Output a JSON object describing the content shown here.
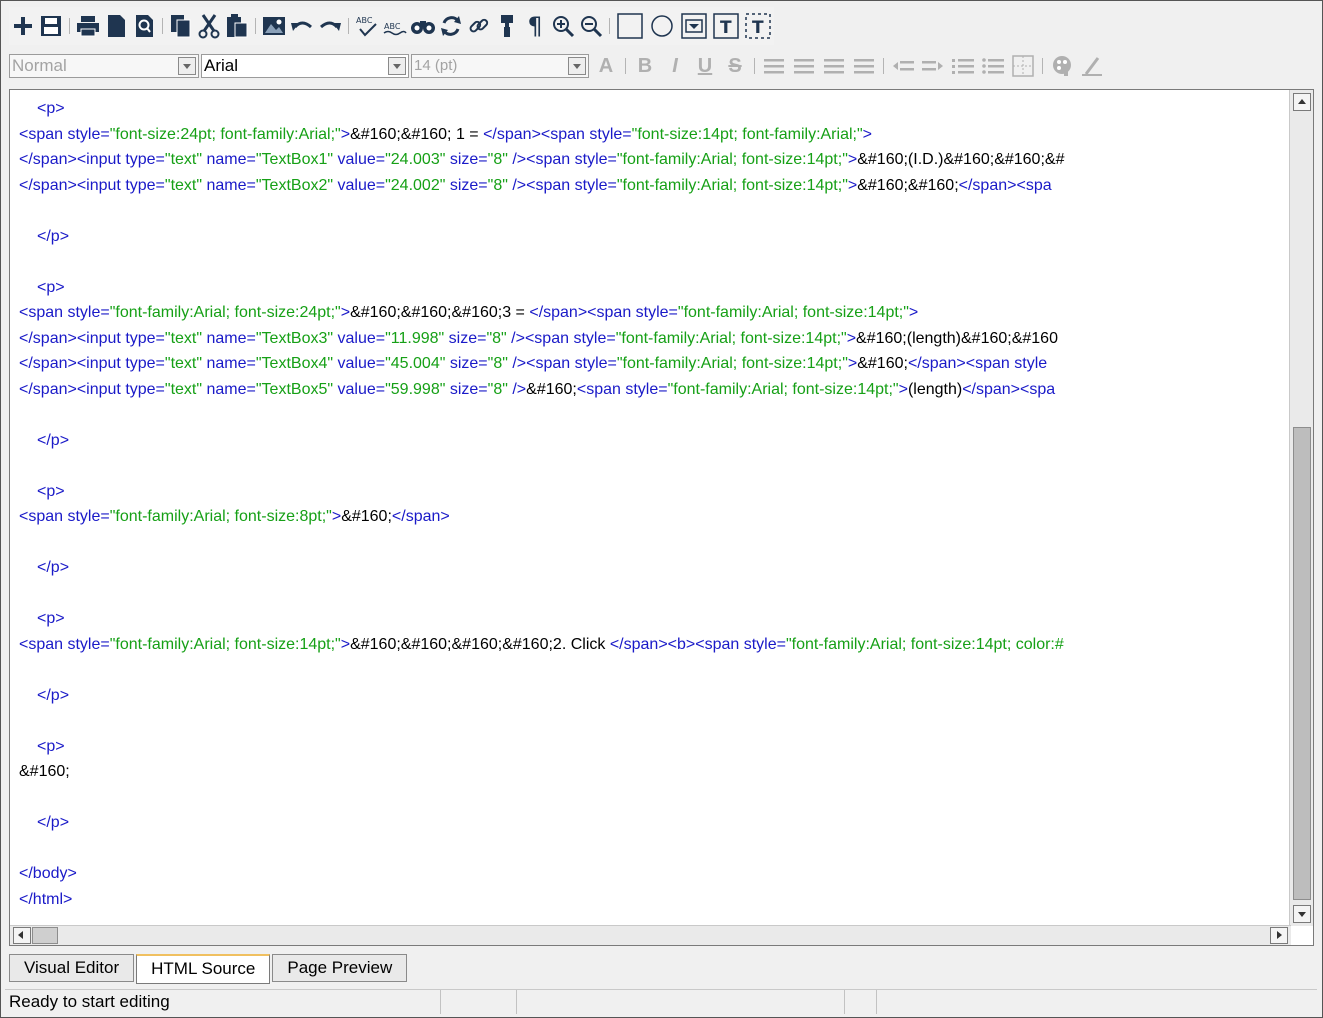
{
  "toolbar_main": {
    "buttons": [
      "new",
      "save",
      "print",
      "new-page",
      "print-preview",
      "copy",
      "cut",
      "paste",
      "insert-image",
      "undo",
      "redo",
      "spell-check",
      "spell-check-alt",
      "find",
      "replace",
      "link",
      "format-painter",
      "paragraph-marks",
      "zoom-in",
      "zoom-out",
      "insert-textbox",
      "insert-radio",
      "insert-dropdown",
      "insert-text-field",
      "insert-text-field-dashed"
    ]
  },
  "toolbar_format": {
    "style_value": "Normal",
    "font_value": "Arial",
    "size_value": "14 (pt)",
    "font_color_label": "A",
    "bold_label": "B",
    "italic_label": "I",
    "underline_label": "U",
    "strike_label": "S"
  },
  "code_lines": [
    {
      "indent": true,
      "parts": [
        {
          "t": "tag",
          "s": "<p>"
        }
      ]
    },
    {
      "indent": false,
      "parts": [
        {
          "t": "tag",
          "s": "<span "
        },
        {
          "t": "attr",
          "s": "style="
        },
        {
          "t": "val",
          "s": "\"font-size:24pt; font-family:Arial;\""
        },
        {
          "t": "tag",
          "s": ">"
        },
        {
          "t": "txt",
          "s": "&#160;&#160; 1 = "
        },
        {
          "t": "tag",
          "s": "</span><span "
        },
        {
          "t": "attr",
          "s": "style="
        },
        {
          "t": "val",
          "s": "\"font-size:14pt; font-family:Arial;\""
        },
        {
          "t": "tag",
          "s": ">"
        }
      ]
    },
    {
      "indent": false,
      "parts": [
        {
          "t": "tag",
          "s": "</span><input "
        },
        {
          "t": "attr",
          "s": "type="
        },
        {
          "t": "val",
          "s": "\"text\""
        },
        {
          "t": "attr",
          "s": " name="
        },
        {
          "t": "val",
          "s": "\"TextBox1\""
        },
        {
          "t": "attr",
          "s": " value="
        },
        {
          "t": "val",
          "s": "\"24.003\""
        },
        {
          "t": "attr",
          "s": " size="
        },
        {
          "t": "val",
          "s": "\"8\""
        },
        {
          "t": "tag",
          "s": " /><span "
        },
        {
          "t": "attr",
          "s": "style="
        },
        {
          "t": "val",
          "s": "\"font-family:Arial; font-size:14pt;\""
        },
        {
          "t": "tag",
          "s": ">"
        },
        {
          "t": "txt",
          "s": "&#160;(I.D.)&#160;&#160;&#"
        }
      ]
    },
    {
      "indent": false,
      "parts": [
        {
          "t": "tag",
          "s": "</span><input "
        },
        {
          "t": "attr",
          "s": "type="
        },
        {
          "t": "val",
          "s": "\"text\""
        },
        {
          "t": "attr",
          "s": " name="
        },
        {
          "t": "val",
          "s": "\"TextBox2\""
        },
        {
          "t": "attr",
          "s": " value="
        },
        {
          "t": "val",
          "s": "\"24.002\""
        },
        {
          "t": "attr",
          "s": " size="
        },
        {
          "t": "val",
          "s": "\"8\""
        },
        {
          "t": "tag",
          "s": " /><span "
        },
        {
          "t": "attr",
          "s": "style="
        },
        {
          "t": "val",
          "s": "\"font-family:Arial; font-size:14pt;\""
        },
        {
          "t": "tag",
          "s": ">"
        },
        {
          "t": "txt",
          "s": "&#160;&#160;"
        },
        {
          "t": "tag",
          "s": "</span><spa"
        }
      ]
    },
    {
      "indent": false,
      "parts": []
    },
    {
      "indent": true,
      "parts": [
        {
          "t": "tag",
          "s": "</p>"
        }
      ]
    },
    {
      "indent": false,
      "parts": []
    },
    {
      "indent": true,
      "parts": [
        {
          "t": "tag",
          "s": "<p>"
        }
      ]
    },
    {
      "indent": false,
      "parts": [
        {
          "t": "tag",
          "s": "<span "
        },
        {
          "t": "attr",
          "s": "style="
        },
        {
          "t": "val",
          "s": "\"font-family:Arial; font-size:24pt;\""
        },
        {
          "t": "tag",
          "s": ">"
        },
        {
          "t": "txt",
          "s": "&#160;&#160;&#160;3 = "
        },
        {
          "t": "tag",
          "s": "</span><span "
        },
        {
          "t": "attr",
          "s": "style="
        },
        {
          "t": "val",
          "s": "\"font-family:Arial; font-size:14pt;\""
        },
        {
          "t": "tag",
          "s": ">"
        }
      ]
    },
    {
      "indent": false,
      "parts": [
        {
          "t": "tag",
          "s": "</span><input "
        },
        {
          "t": "attr",
          "s": "type="
        },
        {
          "t": "val",
          "s": "\"text\""
        },
        {
          "t": "attr",
          "s": " name="
        },
        {
          "t": "val",
          "s": "\"TextBox3\""
        },
        {
          "t": "attr",
          "s": " value="
        },
        {
          "t": "val",
          "s": "\"11.998\""
        },
        {
          "t": "attr",
          "s": " size="
        },
        {
          "t": "val",
          "s": "\"8\""
        },
        {
          "t": "tag",
          "s": " /><span "
        },
        {
          "t": "attr",
          "s": "style="
        },
        {
          "t": "val",
          "s": "\"font-family:Arial; font-size:14pt;\""
        },
        {
          "t": "tag",
          "s": ">"
        },
        {
          "t": "txt",
          "s": "&#160;(length)&#160;&#160"
        }
      ]
    },
    {
      "indent": false,
      "parts": [
        {
          "t": "tag",
          "s": "</span><input "
        },
        {
          "t": "attr",
          "s": "type="
        },
        {
          "t": "val",
          "s": "\"text\""
        },
        {
          "t": "attr",
          "s": " name="
        },
        {
          "t": "val",
          "s": "\"TextBox4\""
        },
        {
          "t": "attr",
          "s": " value="
        },
        {
          "t": "val",
          "s": "\"45.004\""
        },
        {
          "t": "attr",
          "s": " size="
        },
        {
          "t": "val",
          "s": "\"8\""
        },
        {
          "t": "tag",
          "s": " /><span "
        },
        {
          "t": "attr",
          "s": "style="
        },
        {
          "t": "val",
          "s": "\"font-family:Arial; font-size:14pt;\""
        },
        {
          "t": "tag",
          "s": ">"
        },
        {
          "t": "txt",
          "s": "&#160;"
        },
        {
          "t": "tag",
          "s": "</span><span style"
        }
      ]
    },
    {
      "indent": false,
      "parts": [
        {
          "t": "tag",
          "s": "</span><input "
        },
        {
          "t": "attr",
          "s": "type="
        },
        {
          "t": "val",
          "s": "\"text\""
        },
        {
          "t": "attr",
          "s": " name="
        },
        {
          "t": "val",
          "s": "\"TextBox5\""
        },
        {
          "t": "attr",
          "s": " value="
        },
        {
          "t": "val",
          "s": "\"59.998\""
        },
        {
          "t": "attr",
          "s": " size="
        },
        {
          "t": "val",
          "s": "\"8\""
        },
        {
          "t": "tag",
          "s": " />"
        },
        {
          "t": "txt",
          "s": "&#160;"
        },
        {
          "t": "tag",
          "s": "<span "
        },
        {
          "t": "attr",
          "s": "style="
        },
        {
          "t": "val",
          "s": "\"font-family:Arial; font-size:14pt;\""
        },
        {
          "t": "tag",
          "s": ">"
        },
        {
          "t": "txt",
          "s": "(length)"
        },
        {
          "t": "tag",
          "s": "</span><spa"
        }
      ]
    },
    {
      "indent": false,
      "parts": []
    },
    {
      "indent": true,
      "parts": [
        {
          "t": "tag",
          "s": "</p>"
        }
      ]
    },
    {
      "indent": false,
      "parts": []
    },
    {
      "indent": true,
      "parts": [
        {
          "t": "tag",
          "s": "<p>"
        }
      ]
    },
    {
      "indent": false,
      "parts": [
        {
          "t": "tag",
          "s": "<span "
        },
        {
          "t": "attr",
          "s": "style="
        },
        {
          "t": "val",
          "s": "\"font-family:Arial; font-size:8pt;\""
        },
        {
          "t": "tag",
          "s": ">"
        },
        {
          "t": "txt",
          "s": "&#160;"
        },
        {
          "t": "tag",
          "s": "</span>"
        }
      ]
    },
    {
      "indent": false,
      "parts": []
    },
    {
      "indent": true,
      "parts": [
        {
          "t": "tag",
          "s": "</p>"
        }
      ]
    },
    {
      "indent": false,
      "parts": []
    },
    {
      "indent": true,
      "parts": [
        {
          "t": "tag",
          "s": "<p>"
        }
      ]
    },
    {
      "indent": false,
      "parts": [
        {
          "t": "tag",
          "s": "<span "
        },
        {
          "t": "attr",
          "s": "style="
        },
        {
          "t": "val",
          "s": "\"font-family:Arial; font-size:14pt;\""
        },
        {
          "t": "tag",
          "s": ">"
        },
        {
          "t": "txt",
          "s": "&#160;&#160;&#160;&#160;2. Click "
        },
        {
          "t": "tag",
          "s": "</span><b><span "
        },
        {
          "t": "attr",
          "s": "style="
        },
        {
          "t": "val",
          "s": "\"font-family:Arial; font-size:14pt; color:#"
        }
      ]
    },
    {
      "indent": false,
      "parts": []
    },
    {
      "indent": true,
      "parts": [
        {
          "t": "tag",
          "s": "</p>"
        }
      ]
    },
    {
      "indent": false,
      "parts": []
    },
    {
      "indent": true,
      "parts": [
        {
          "t": "tag",
          "s": "<p>"
        }
      ]
    },
    {
      "indent": false,
      "parts": [
        {
          "t": "txt",
          "s": "&#160;"
        }
      ]
    },
    {
      "indent": false,
      "parts": []
    },
    {
      "indent": true,
      "parts": [
        {
          "t": "tag",
          "s": "</p>"
        }
      ]
    },
    {
      "indent": false,
      "parts": []
    },
    {
      "indent": false,
      "parts": [
        {
          "t": "tag",
          "s": "</body>"
        }
      ]
    },
    {
      "indent": false,
      "parts": [
        {
          "t": "tag",
          "s": "</html>"
        }
      ]
    }
  ],
  "tabs": [
    {
      "label": "Visual Editor",
      "active": false
    },
    {
      "label": "HTML Source",
      "active": true
    },
    {
      "label": "Page Preview",
      "active": false
    }
  ],
  "status": {
    "message": "Ready to start editing"
  },
  "colors": {
    "tag": "#1a1ac8",
    "value": "#16a016",
    "text": "#000000",
    "toolbar_icon": "#1f3550"
  }
}
